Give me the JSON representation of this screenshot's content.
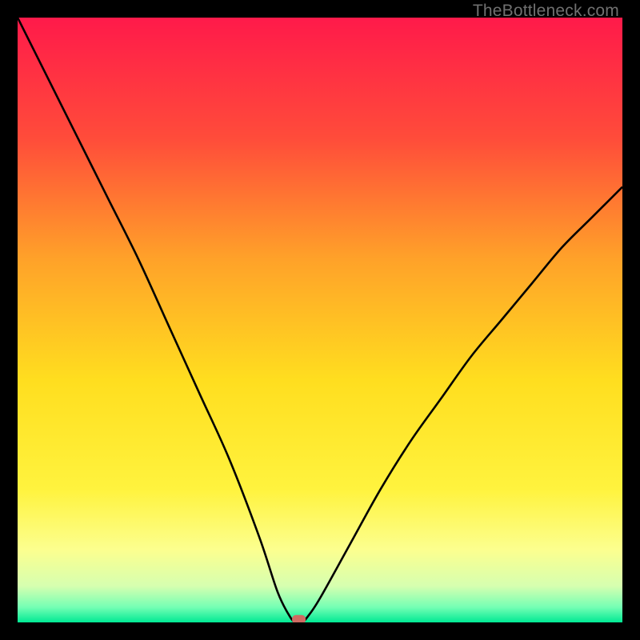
{
  "watermark": "TheBottleneck.com",
  "chart_data": {
    "type": "line",
    "title": "",
    "xlabel": "",
    "ylabel": "",
    "xlim": [
      0,
      100
    ],
    "ylim": [
      0,
      100
    ],
    "grid": false,
    "legend": false,
    "background_gradient": {
      "stops": [
        {
          "pos": 0.0,
          "color": "#ff1a4a"
        },
        {
          "pos": 0.2,
          "color": "#ff4c3a"
        },
        {
          "pos": 0.4,
          "color": "#ffa229"
        },
        {
          "pos": 0.6,
          "color": "#ffde1f"
        },
        {
          "pos": 0.78,
          "color": "#fff33e"
        },
        {
          "pos": 0.88,
          "color": "#fcff8f"
        },
        {
          "pos": 0.94,
          "color": "#d6ffb0"
        },
        {
          "pos": 0.975,
          "color": "#74ffb4"
        },
        {
          "pos": 1.0,
          "color": "#00e994"
        }
      ]
    },
    "series": [
      {
        "name": "curve",
        "x": [
          0,
          5,
          10,
          15,
          20,
          25,
          30,
          35,
          40,
          43,
          45,
          46,
          47,
          48,
          50,
          55,
          60,
          65,
          70,
          75,
          80,
          85,
          90,
          95,
          100
        ],
        "y": [
          100,
          90,
          80,
          70,
          60,
          49,
          38,
          27,
          14,
          5,
          1,
          0,
          0,
          1,
          4,
          13,
          22,
          30,
          37,
          44,
          50,
          56,
          62,
          67,
          72
        ]
      }
    ],
    "marker": {
      "x": 46.5,
      "y": 0.5,
      "color": "#cf6a62"
    }
  }
}
